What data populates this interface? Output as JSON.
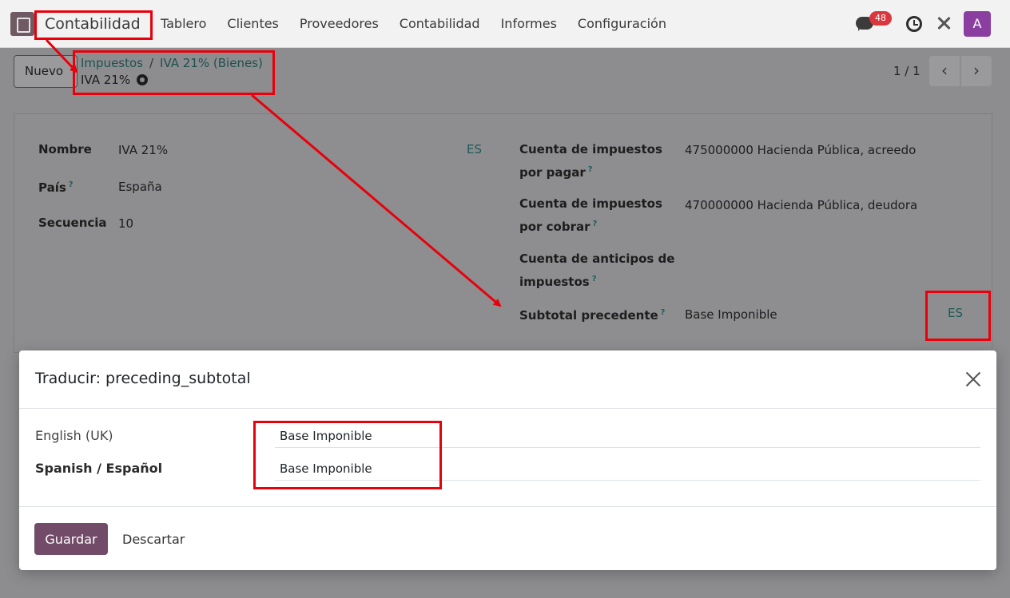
{
  "navbar": {
    "brand": "Contabilidad",
    "menu": [
      "Tablero",
      "Clientes",
      "Proveedores",
      "Contabilidad",
      "Informes",
      "Configuración"
    ],
    "message_count": "48",
    "avatar_initial": "A"
  },
  "control": {
    "new_button": "Nuevo",
    "breadcrumb": [
      "Impuestos",
      "IVA 21% (Bienes)"
    ],
    "record_name": "IVA 21%",
    "pager": "1 / 1"
  },
  "form": {
    "left": [
      {
        "label": "Nombre",
        "value": "IVA 21%"
      },
      {
        "label": "País",
        "value": "España"
      },
      {
        "label": "Secuencia",
        "value": "10"
      }
    ],
    "lang_code": "ES",
    "right": [
      {
        "label_line1": "Cuenta de impuestos",
        "label_line2": "por pagar",
        "value": "475000000 Hacienda Pública, acreedo"
      },
      {
        "label_line1": "Cuenta de impuestos",
        "label_line2": "por cobrar",
        "value": "470000000 Hacienda Pública, deudora"
      },
      {
        "label_line1": "Cuenta de anticipos de",
        "label_line2": "impuestos",
        "value": ""
      },
      {
        "label_line1": "Subtotal precedente",
        "label_line2": "",
        "value": "Base Imponible"
      }
    ]
  },
  "dialog": {
    "title": "Traducir: preceding_subtotal",
    "rows": [
      {
        "language": "English (UK)",
        "value": "Base Imponible"
      },
      {
        "language": "Spanish / Español",
        "value": "Base Imponible"
      }
    ],
    "save": "Guardar",
    "discard": "Descartar"
  },
  "colors": {
    "annotation": "#e8000b",
    "primary": "#714b67",
    "link": "#1f4f4e"
  }
}
